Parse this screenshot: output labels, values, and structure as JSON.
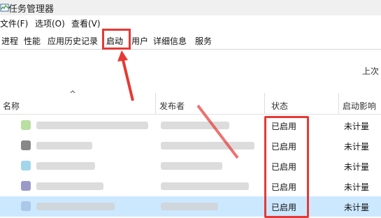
{
  "window": {
    "title": "任务管理器"
  },
  "menubar": {
    "items": [
      "文件(F)",
      "选项(O)",
      "查看(V)"
    ]
  },
  "tabs": [
    "进程",
    "性能",
    "应用历史记录",
    "启动",
    "用户",
    "详细信息",
    "服务"
  ],
  "active_tab": "启动",
  "toolbar": {
    "right_text": "上次"
  },
  "table": {
    "headers": {
      "name": "名称",
      "publisher": "发布者",
      "status": "状态",
      "impact": "启动影响"
    },
    "rows": [
      {
        "status": "已启用",
        "impact": "未计量",
        "icon_color": "#9bd27a"
      },
      {
        "status": "已启用",
        "impact": "未计量",
        "icon_color": "#555555"
      },
      {
        "status": "已启用",
        "impact": "未计量",
        "icon_color": "#7cc3e6"
      },
      {
        "status": "已启用",
        "impact": "未计量",
        "icon_color": "#6f6fb0"
      },
      {
        "status": "已启用",
        "impact": "未计量",
        "icon_color": "#9bbbe0",
        "selected": true
      }
    ]
  },
  "colors": {
    "annotation_red": "#e53935",
    "selection": "#cce8ff"
  }
}
